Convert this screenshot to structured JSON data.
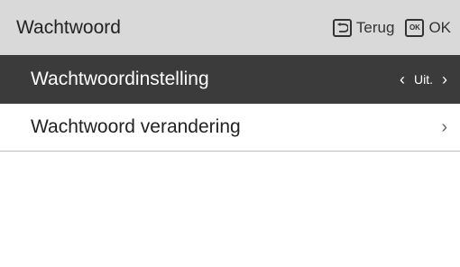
{
  "header": {
    "title": "Wachtwoord",
    "back_label": "Terug",
    "ok_key": "OK",
    "ok_label": "OK",
    "back_icon": "back-arrow-icon"
  },
  "menu": {
    "items": [
      {
        "label": "Wachtwoordinstelling",
        "value": "Uit.",
        "selected": true,
        "left_arrow": "‹",
        "right_arrow": "›"
      },
      {
        "label": "Wachtwoord verandering",
        "selected": false,
        "right_arrow": "›"
      }
    ]
  },
  "colors": {
    "header_bg": "#d9d9d9",
    "selected_bg": "#3b3b3b",
    "selected_text": "#ffffff",
    "text": "#222222"
  }
}
